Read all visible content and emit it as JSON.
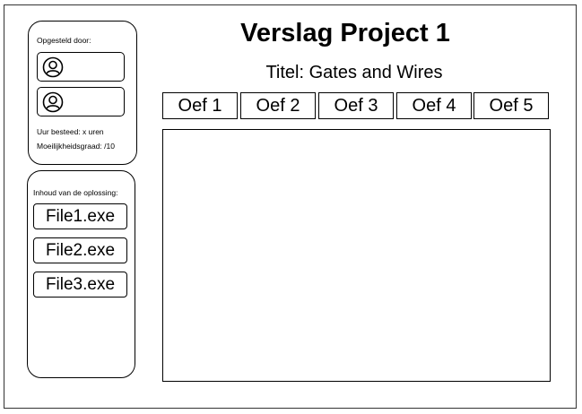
{
  "header": {
    "title": "Verslag Project 1",
    "subtitle": "Titel: Gates and Wires"
  },
  "authors_panel": {
    "heading": "Opgesteld door:",
    "authors": [
      {
        "icon": "user-avatar-icon"
      },
      {
        "icon": "user-avatar-icon"
      }
    ],
    "hours_spent": "Uur besteed: x uren",
    "difficulty": "Moeilijkheidsgraad: /10"
  },
  "contents_panel": {
    "heading": "Inhoud van de oplossing:",
    "files": [
      "File1.exe",
      "File2.exe",
      "File3.exe"
    ]
  },
  "tabs": [
    "Oef 1",
    "Oef 2",
    "Oef 3",
    "Oef 4",
    "Oef 5"
  ]
}
